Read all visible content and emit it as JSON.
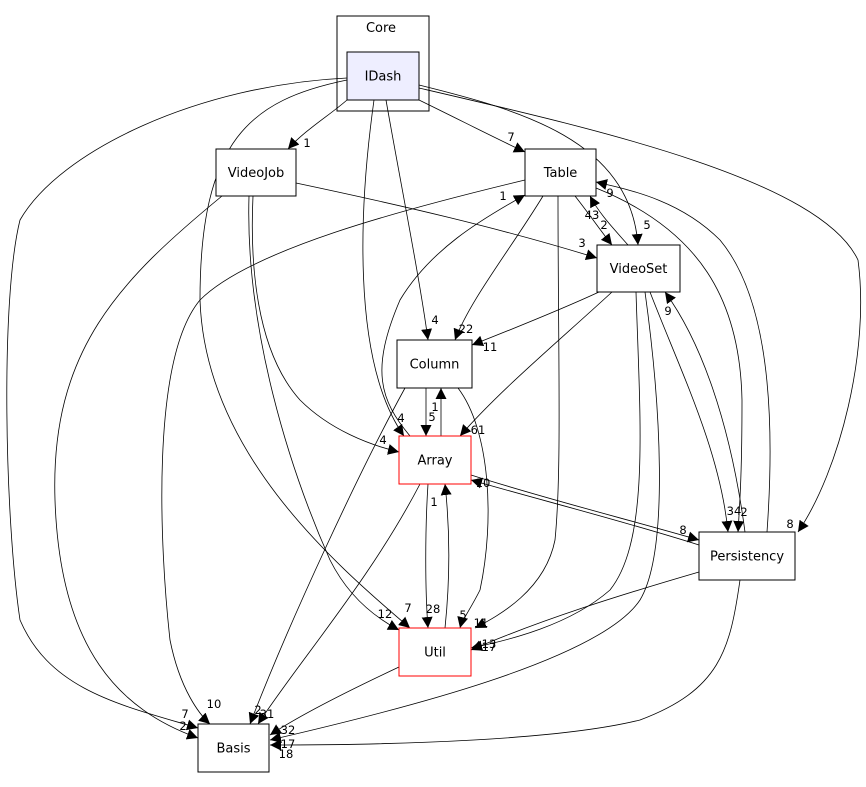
{
  "cluster": {
    "label": "Core"
  },
  "nodes": {
    "IDash": {
      "label": "IDash",
      "fill": "#eeeeff",
      "border": "#000000"
    },
    "VideoJob": {
      "label": "VideoJob",
      "border": "#000000"
    },
    "Table": {
      "label": "Table",
      "border": "#000000"
    },
    "VideoSet": {
      "label": "VideoSet",
      "border": "#000000"
    },
    "Column": {
      "label": "Column",
      "border": "#000000"
    },
    "Array": {
      "label": "Array",
      "border": "#ff0000"
    },
    "Persistency": {
      "label": "Persistency",
      "border": "#000000"
    },
    "Util": {
      "label": "Util",
      "border": "#ff0000"
    },
    "Basis": {
      "label": "Basis",
      "border": "#000000"
    }
  },
  "edges": [
    {
      "from": "IDash",
      "to": "VideoJob",
      "label": "1"
    },
    {
      "from": "IDash",
      "to": "Table",
      "label": "7"
    },
    {
      "from": "IDash",
      "to": "VideoSet",
      "label": "5"
    },
    {
      "from": "IDash",
      "to": "Persistency",
      "label": "8"
    },
    {
      "from": "IDash",
      "to": "Column",
      "label": "4"
    },
    {
      "from": "IDash",
      "to": "Array",
      "label": "4"
    },
    {
      "from": "IDash",
      "to": "Util",
      "label": "7"
    },
    {
      "from": "IDash",
      "to": "Basis",
      "label": "7"
    },
    {
      "from": "VideoJob",
      "to": "VideoSet",
      "label": "3"
    },
    {
      "from": "VideoJob",
      "to": "Array",
      "label": "4"
    },
    {
      "from": "VideoJob",
      "to": "Util",
      "label": "12"
    },
    {
      "from": "VideoJob",
      "to": "Basis",
      "label": "2"
    },
    {
      "from": "Table",
      "to": "Column",
      "label": "22"
    },
    {
      "from": "Table",
      "to": "VideoSet",
      "label": "2"
    },
    {
      "from": "Table",
      "to": "Util",
      "label": "11"
    },
    {
      "from": "Table",
      "to": "Basis",
      "label": "10"
    },
    {
      "from": "VideoSet",
      "to": "Table",
      "label": "43"
    },
    {
      "from": "VideoSet",
      "to": "Column",
      "label": "11"
    },
    {
      "from": "VideoSet",
      "to": "Array",
      "label": "61"
    },
    {
      "from": "VideoSet",
      "to": "Persistency",
      "label": "34"
    },
    {
      "from": "VideoSet",
      "to": "Util",
      "label": "17"
    },
    {
      "from": "VideoSet",
      "to": "Basis",
      "label": "32"
    },
    {
      "from": "Column",
      "to": "Array",
      "label": "5"
    },
    {
      "from": "Column",
      "to": "Util",
      "label": "5"
    },
    {
      "from": "Column",
      "to": "Basis",
      "label": "2"
    },
    {
      "from": "Array",
      "to": "Column",
      "label": "1"
    },
    {
      "from": "Array",
      "to": "Table",
      "label": "1"
    },
    {
      "from": "Array",
      "to": "Util",
      "label": "28"
    },
    {
      "from": "Array",
      "to": "Persistency",
      "label": "8"
    },
    {
      "from": "Array",
      "to": "Basis",
      "label": "31"
    },
    {
      "from": "Persistency",
      "to": "Array",
      "label": "10"
    },
    {
      "from": "Persistency",
      "to": "Table",
      "label": "9"
    },
    {
      "from": "Persistency",
      "to": "VideoSet",
      "label": "9"
    },
    {
      "from": "Persistency",
      "to": "Util",
      "label": "13"
    },
    {
      "from": "Persistency",
      "to": "Basis",
      "label": "17"
    },
    {
      "from": "Util",
      "to": "Array",
      "label": "1"
    },
    {
      "from": "Util",
      "to": "Basis",
      "label": "18"
    },
    {
      "from": "Table",
      "to": "Persistency",
      "label": "2"
    }
  ]
}
